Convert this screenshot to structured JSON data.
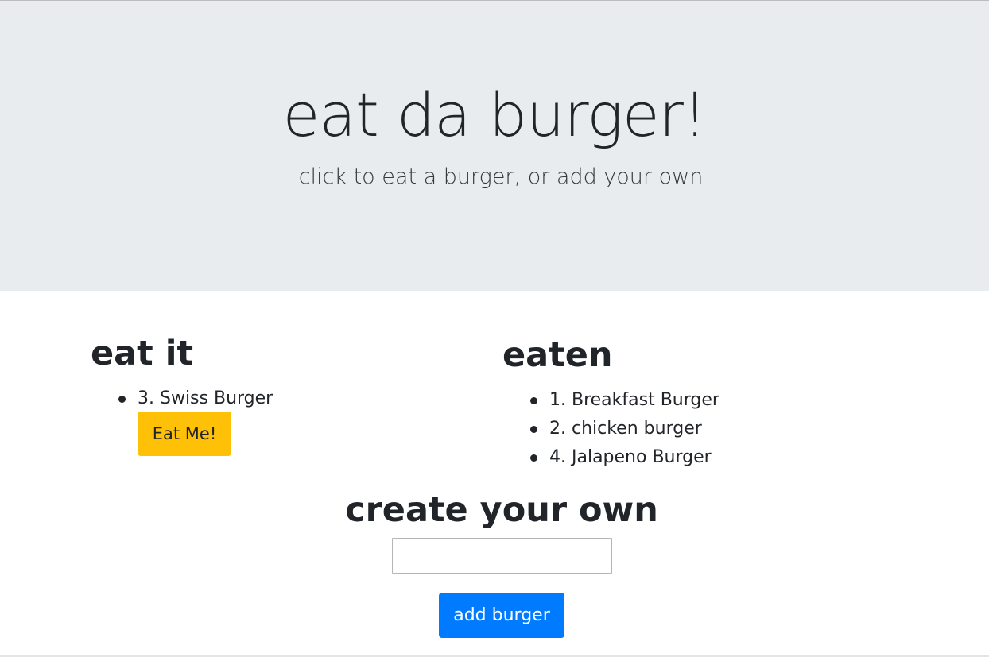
{
  "header": {
    "title": "eat da burger!",
    "subtitle": "click to eat a burger, or add your own"
  },
  "eat_it": {
    "heading": "eat it",
    "items": [
      {
        "label": "3. Swiss Burger",
        "button_label": "Eat Me!"
      }
    ]
  },
  "eaten": {
    "heading": "eaten",
    "items": [
      {
        "label": "1. Breakfast Burger"
      },
      {
        "label": "2. chicken burger"
      },
      {
        "label": "4. Jalapeno Burger"
      }
    ]
  },
  "create": {
    "heading": "create your own",
    "input_value": "",
    "input_placeholder": "",
    "button_label": "add burger"
  },
  "colors": {
    "jumbotron_bg": "#e9ecef",
    "eat_button": "#ffc107",
    "add_button": "#007bff",
    "text": "#212529"
  }
}
